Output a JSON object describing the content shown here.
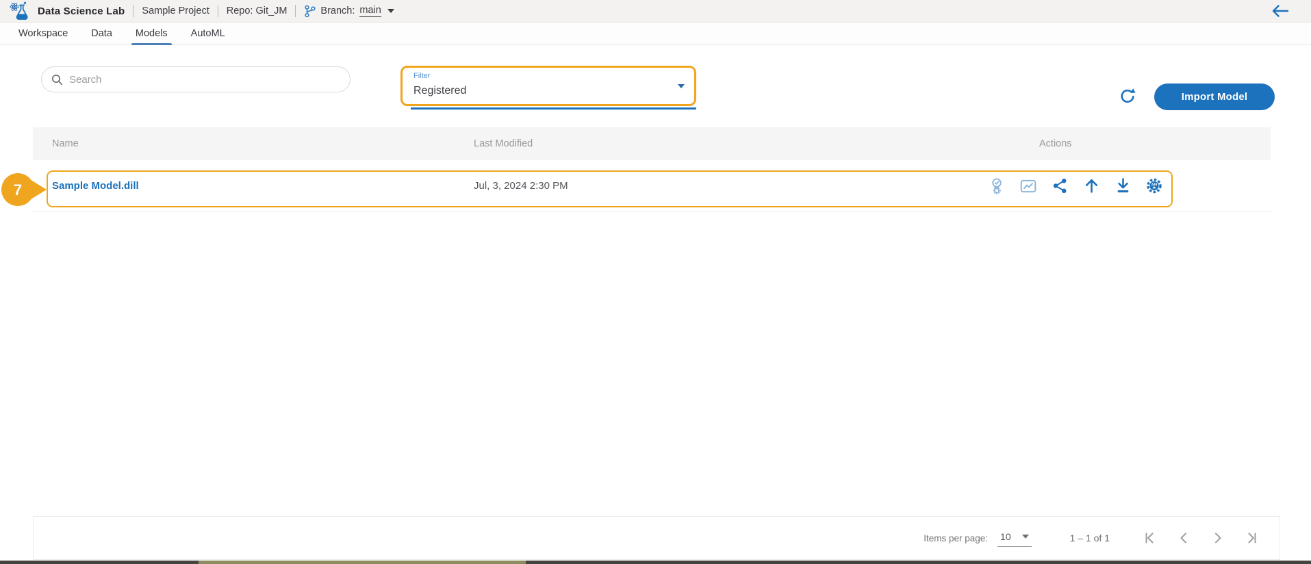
{
  "header": {
    "logo_icon": "flask-atom-logo",
    "app_title": "Data Science Lab",
    "project_name": "Sample Project",
    "repo_label": "Repo: Git_JM",
    "branch_icon": "git-branch",
    "branch_prefix": "Branch:",
    "branch_name": "main",
    "back_icon": "arrow-left"
  },
  "tabs": [
    {
      "label": "Workspace",
      "active": false
    },
    {
      "label": "Data",
      "active": false
    },
    {
      "label": "Models",
      "active": true
    },
    {
      "label": "AutoML",
      "active": false
    }
  ],
  "toolbar": {
    "search_icon": "magnifier",
    "search_placeholder": "Search",
    "filter_label": "Filter",
    "filter_value": "Registered",
    "refresh_icon": "refresh",
    "import_button_label": "Import Model"
  },
  "table": {
    "columns": [
      "Name",
      "Last Modified",
      "Actions"
    ],
    "rows": [
      {
        "name": "Sample Model.dill",
        "last_modified": "Jul, 3, 2024 2:30 PM",
        "action_icons": [
          "model-insights",
          "metrics-chart",
          "share",
          "publish-up",
          "download",
          "deploy-api"
        ]
      }
    ]
  },
  "step_badge": {
    "number": "7"
  },
  "paginator": {
    "items_per_page_label": "Items per page:",
    "items_per_page_value": "10",
    "range_label": "1 – 1 of 1",
    "nav_icons": [
      "first-page",
      "previous-page",
      "next-page",
      "last-page"
    ]
  },
  "colors": {
    "primary_blue": "#1C72BC",
    "light_icon_blue": "#8DB6DA",
    "annotation_orange": "#F0A51F",
    "tab_underline_blue": "#4A82B8",
    "muted_text": "#98989D"
  }
}
